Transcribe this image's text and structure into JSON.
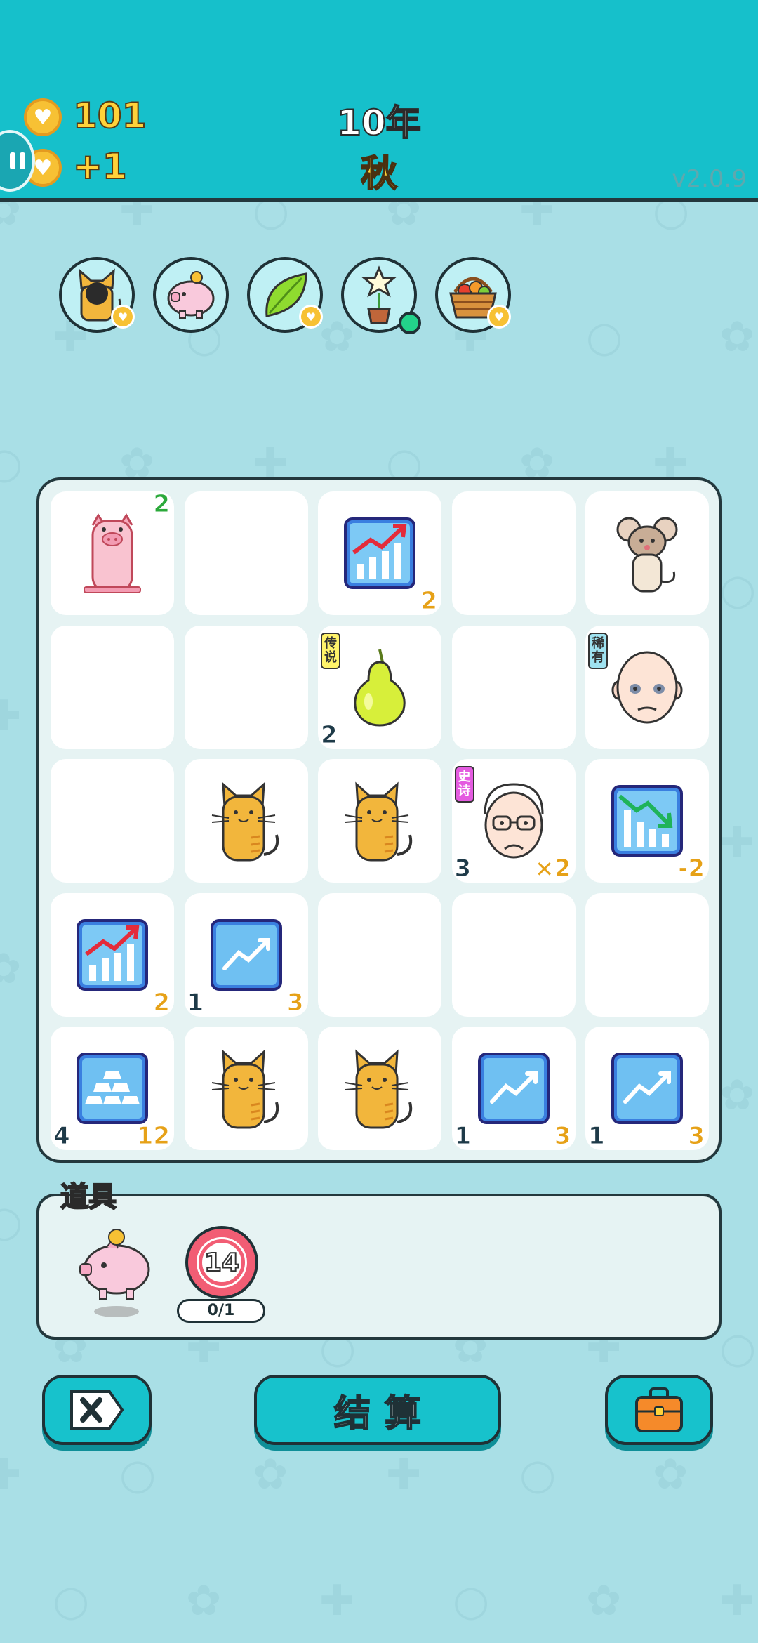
{
  "header": {
    "coins": "101",
    "income": "+1",
    "year": "10年",
    "season": "秋",
    "version": "v2.0.9"
  },
  "relics": [
    {
      "icon": "cat-burglar-icon",
      "badge": "coin"
    },
    {
      "icon": "piggy-bank-icon",
      "badge": "none"
    },
    {
      "icon": "leaf-icon",
      "badge": "coin"
    },
    {
      "icon": "potted-flower-icon",
      "badge": "green-dot"
    },
    {
      "icon": "fruit-basket-icon",
      "badge": "coin"
    }
  ],
  "board": {
    "rows": [
      [
        {
          "symbol": "pig",
          "tr": "2"
        },
        {
          "symbol": "empty"
        },
        {
          "symbol": "stock-up-chart",
          "br": "2"
        },
        {
          "symbol": "empty"
        },
        {
          "symbol": "rat"
        }
      ],
      [
        {
          "symbol": "empty"
        },
        {
          "symbol": "empty"
        },
        {
          "symbol": "pear",
          "tag": "传说",
          "tag_color": "#fff36a",
          "bl": "2"
        },
        {
          "symbol": "empty"
        },
        {
          "symbol": "bald-man",
          "tag": "稀有",
          "tag_color": "#9fe2f0"
        }
      ],
      [
        {
          "symbol": "empty"
        },
        {
          "symbol": "cat"
        },
        {
          "symbol": "cat"
        },
        {
          "symbol": "old-man",
          "tag": "史诗",
          "tag_color": "#e45be0",
          "bl": "3",
          "br": "×2"
        },
        {
          "symbol": "stock-down-chart",
          "br": "-2"
        }
      ],
      [
        {
          "symbol": "stock-up-chart",
          "br": "2"
        },
        {
          "symbol": "trend-card",
          "bl": "1",
          "br": "3"
        },
        {
          "symbol": "empty"
        },
        {
          "symbol": "empty"
        },
        {
          "symbol": "empty"
        }
      ],
      [
        {
          "symbol": "gold-bars",
          "bl": "4",
          "br": "12"
        },
        {
          "symbol": "cat"
        },
        {
          "symbol": "cat"
        },
        {
          "symbol": "trend-card",
          "bl": "1",
          "br": "3"
        },
        {
          "symbol": "trend-card",
          "bl": "1",
          "br": "3"
        }
      ]
    ]
  },
  "items": {
    "label": "道具",
    "rings_count": "14",
    "progress": "0/1"
  },
  "buttons": {
    "settle_label": "结算"
  }
}
